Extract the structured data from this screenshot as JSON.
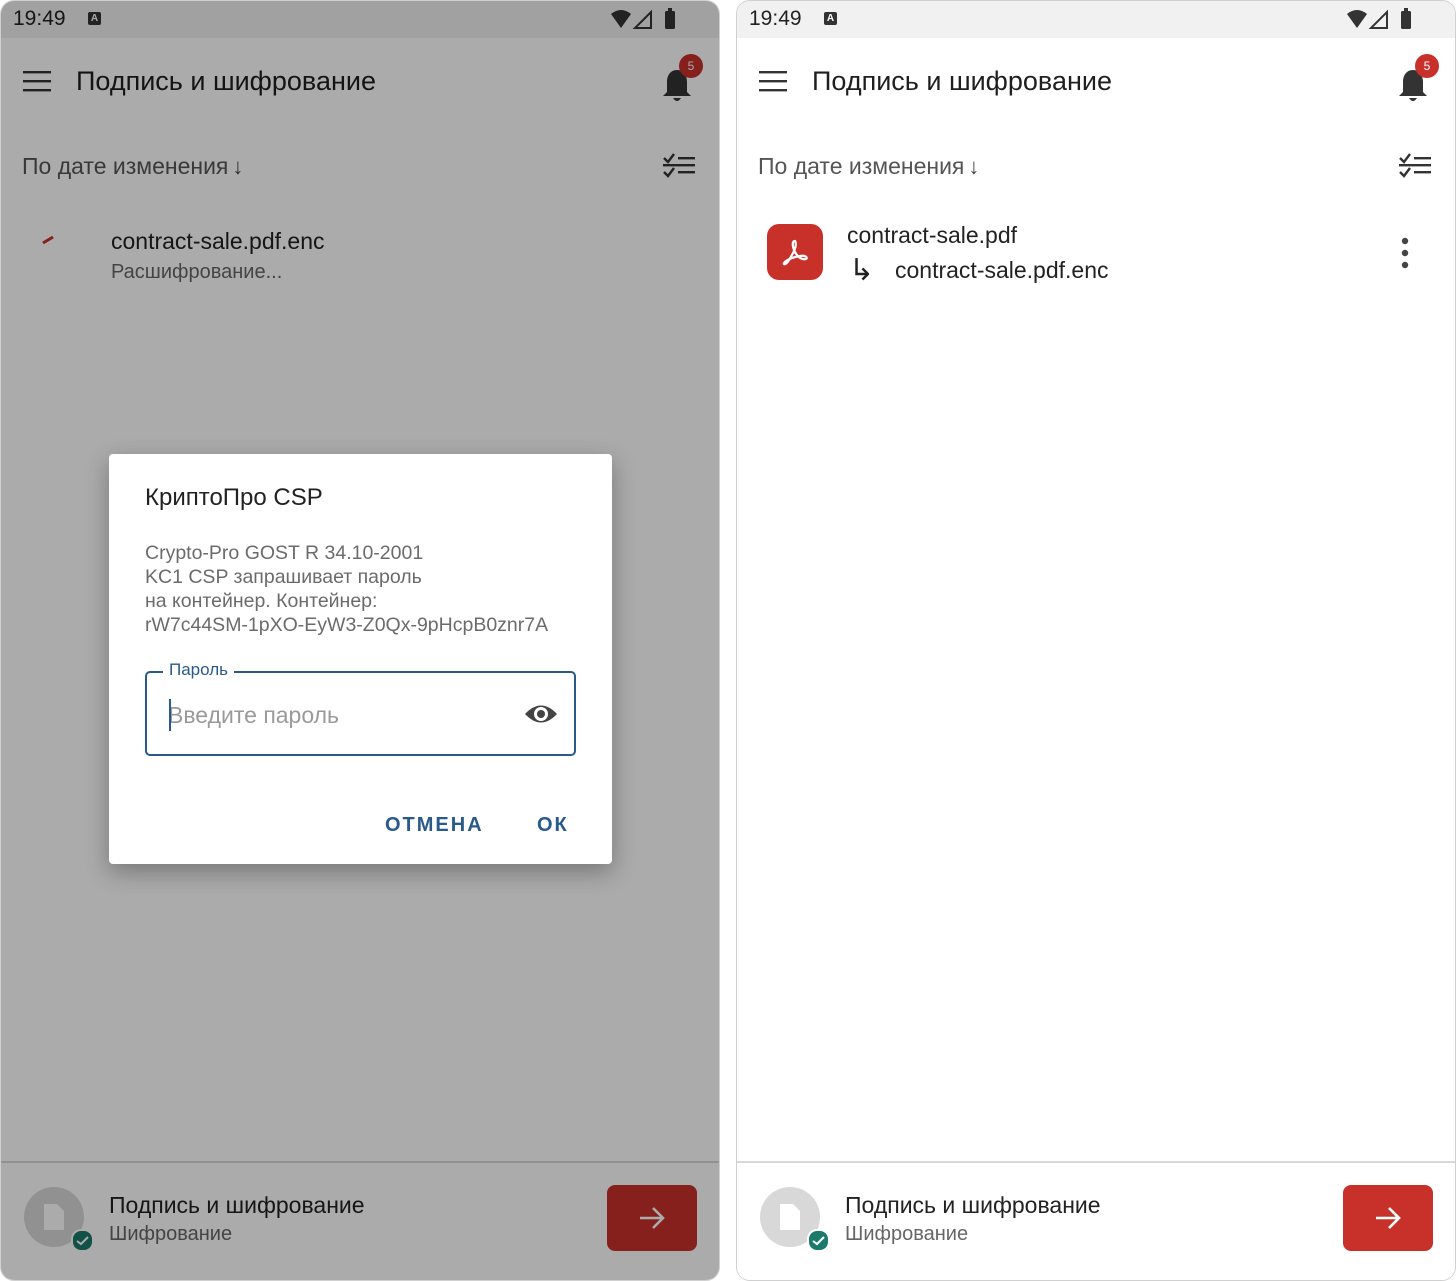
{
  "status_bar": {
    "time": "19:49",
    "indicator": "A"
  },
  "app_bar": {
    "title": "Подпись и шифрование",
    "notification_count": "5"
  },
  "sort": {
    "label": "По дате изменения",
    "arrow": "↓"
  },
  "left_screen": {
    "file": {
      "name": "contract-sale.pdf.enc",
      "status": "Расшифрование..."
    },
    "dialog": {
      "title": "КриптоПро CSP",
      "message_lines": [
        "Crypto-Pro GOST R 34.10-2001",
        "KC1 CSP запрашивает пароль",
        "на контейнер. Контейнер:",
        "rW7c44SM-1pXO-EyW3-Z0Qx-9pHcpB0znr7A"
      ],
      "password_label": "Пароль",
      "password_placeholder": "Введите пароль",
      "password_value": "",
      "cancel_label": "ОТМЕНА",
      "ok_label": "ОК"
    }
  },
  "right_screen": {
    "file": {
      "name": "contract-sale.pdf",
      "child": "contract-sale.pdf.enc",
      "child_arrow": "↳"
    }
  },
  "bottom_bar": {
    "title": "Подпись и шифрование",
    "subtitle": "Шифрование"
  },
  "colors": {
    "accent_red": "#c8312a",
    "dialog_blue": "#2a5a8c",
    "check_teal": "#1b7a6a"
  },
  "icons": [
    "menu-icon",
    "bell-icon",
    "checklist-icon",
    "pdf-icon",
    "more-vert-icon",
    "eye-icon",
    "document-icon",
    "check-icon",
    "arrow-right-icon",
    "wifi-icon",
    "signal-icon",
    "battery-icon"
  ]
}
